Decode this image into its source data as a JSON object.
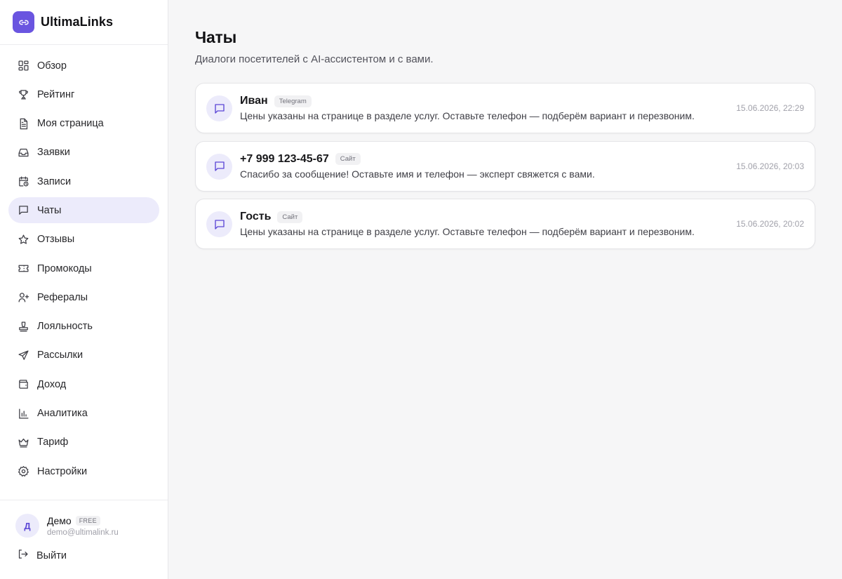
{
  "brand": {
    "name": "UltimaLinks",
    "logo_icon": "link-icon",
    "accent": "#6a55e0"
  },
  "sidebar": {
    "items": [
      {
        "label": "Обзор",
        "icon": "dashboard-icon",
        "active": false
      },
      {
        "label": "Рейтинг",
        "icon": "trophy-icon",
        "active": false
      },
      {
        "label": "Моя страница",
        "icon": "file-text-icon",
        "active": false
      },
      {
        "label": "Заявки",
        "icon": "inbox-icon",
        "active": false
      },
      {
        "label": "Записи",
        "icon": "calendar-clock-icon",
        "active": false
      },
      {
        "label": "Чаты",
        "icon": "chat-icon",
        "active": true
      },
      {
        "label": "Отзывы",
        "icon": "star-icon",
        "active": false
      },
      {
        "label": "Промокоды",
        "icon": "ticket-icon",
        "active": false
      },
      {
        "label": "Рефералы",
        "icon": "user-plus-icon",
        "active": false
      },
      {
        "label": "Лояльность",
        "icon": "stamp-icon",
        "active": false
      },
      {
        "label": "Рассылки",
        "icon": "send-icon",
        "active": false
      },
      {
        "label": "Доход",
        "icon": "wallet-icon",
        "active": false
      },
      {
        "label": "Аналитика",
        "icon": "bar-chart-icon",
        "active": false
      },
      {
        "label": "Тариф",
        "icon": "crown-icon",
        "active": false
      },
      {
        "label": "Настройки",
        "icon": "gear-icon",
        "active": false
      }
    ]
  },
  "user": {
    "initial": "Д",
    "name": "Демо",
    "plan": "FREE",
    "email": "demo@ultimalink.ru",
    "logout_label": "Выйти"
  },
  "page": {
    "title": "Чаты",
    "subtitle": "Диалоги посетителей с AI-ассистентом и с вами."
  },
  "chats": [
    {
      "name": "Иван",
      "source": "Telegram",
      "message": "Цены указаны на странице в разделе услуг. Оставьте телефон — подберём вариант и перезвоним.",
      "time": "15.06.2026, 22:29"
    },
    {
      "name": "+7 999 123-45-67",
      "source": "Сайт",
      "message": "Спасибо за сообщение! Оставьте имя и телефон — эксперт свяжется с вами.",
      "time": "15.06.2026, 20:03"
    },
    {
      "name": "Гость",
      "source": "Сайт",
      "message": "Цены указаны на странице в разделе услуг. Оставьте телефон — подберём вариант и перезвоним.",
      "time": "15.06.2026, 20:02"
    }
  ]
}
